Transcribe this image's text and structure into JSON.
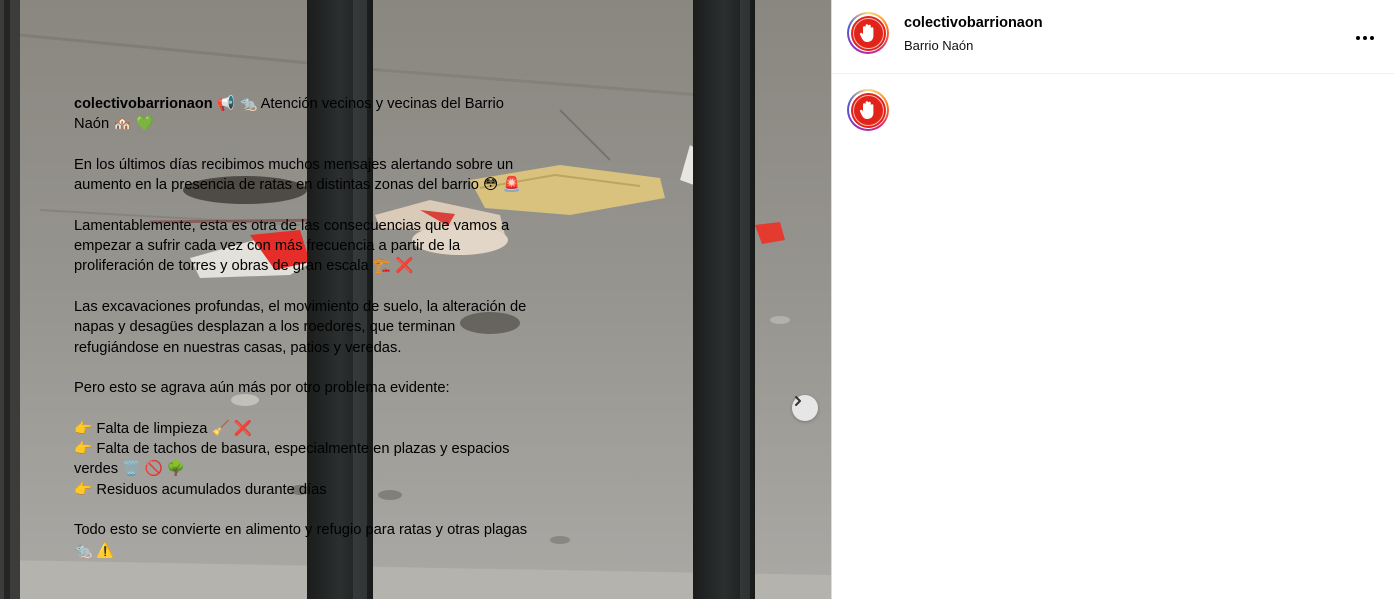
{
  "post": {
    "username": "colectivobarrionaon",
    "location": "Barrio Naón"
  },
  "icons": {
    "avatar": "raised-hand-logo-icon",
    "more": "more-options-icon",
    "next": "chevron-right-icon"
  },
  "colors": {
    "avatar_red": "#e2231a",
    "text": "#000000",
    "divider": "#dbdbdb"
  },
  "caption": {
    "line1": "📢 🐀 Atención vecinos y vecinas del Barrio Naón 🏘️ 💚",
    "p2": "En los últimos días recibimos muchos mensajes alertando sobre un aumento en la presencia de ratas en distintas zonas del barrio 😳 🚨",
    "p3": "Lamentablemente, esta es otra de las consecuencias que vamos a empezar a sufrir cada vez con más frecuencia a partir de la proliferación de torres y obras de gran escala 🏗️ ❌",
    "p4": "Las excavaciones profundas, el movimiento de suelo, la alteración de napas y desagües desplazan a los roedores, que terminan refugiándose en nuestras casas, patios y veredas.",
    "p5": "Pero esto se agrava aún más por otro problema evidente:",
    "bullet1": "👉 Falta de limpieza 🧹 ❌",
    "bullet2": "👉 Falta de tachos de basura, especialmente en plazas y espacios verdes 🗑️ 🚫 🌳",
    "bullet3": "👉 Residuos acumulados durante días",
    "p7": "Todo esto se convierte en alimento y refugio para ratas y otras plagas 🐀 ⚠️"
  }
}
